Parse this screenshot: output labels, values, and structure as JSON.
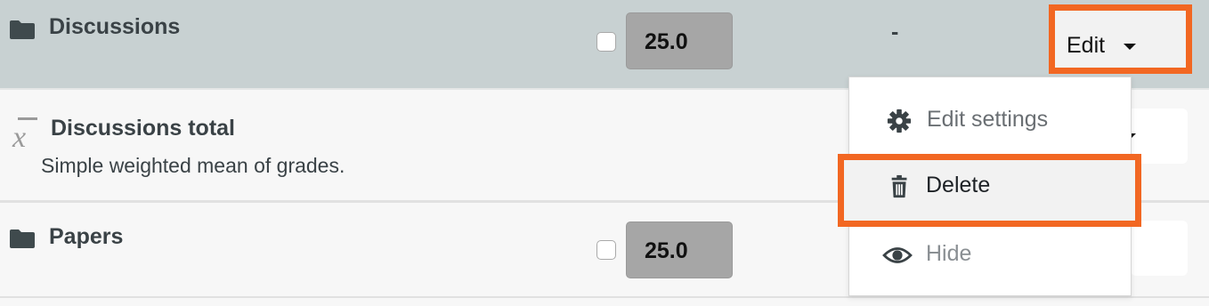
{
  "rows": {
    "discussions": {
      "name": "Discussions",
      "weight": "25.0",
      "dash": "-",
      "edit_label": "Edit"
    },
    "discussions_total": {
      "name": "Discussions total",
      "description": "Simple weighted mean of grades."
    },
    "papers": {
      "name": "Papers",
      "weight": "25.0"
    }
  },
  "menu": {
    "items": [
      {
        "label": "Edit settings",
        "icon": "gear-icon"
      },
      {
        "label": "Delete",
        "icon": "trash-icon"
      },
      {
        "label": "Hide",
        "icon": "eye-icon"
      }
    ]
  },
  "colors": {
    "highlight": "#f26722",
    "row_selected": "#c8d1d2",
    "weight_box": "#a6a6a6"
  }
}
